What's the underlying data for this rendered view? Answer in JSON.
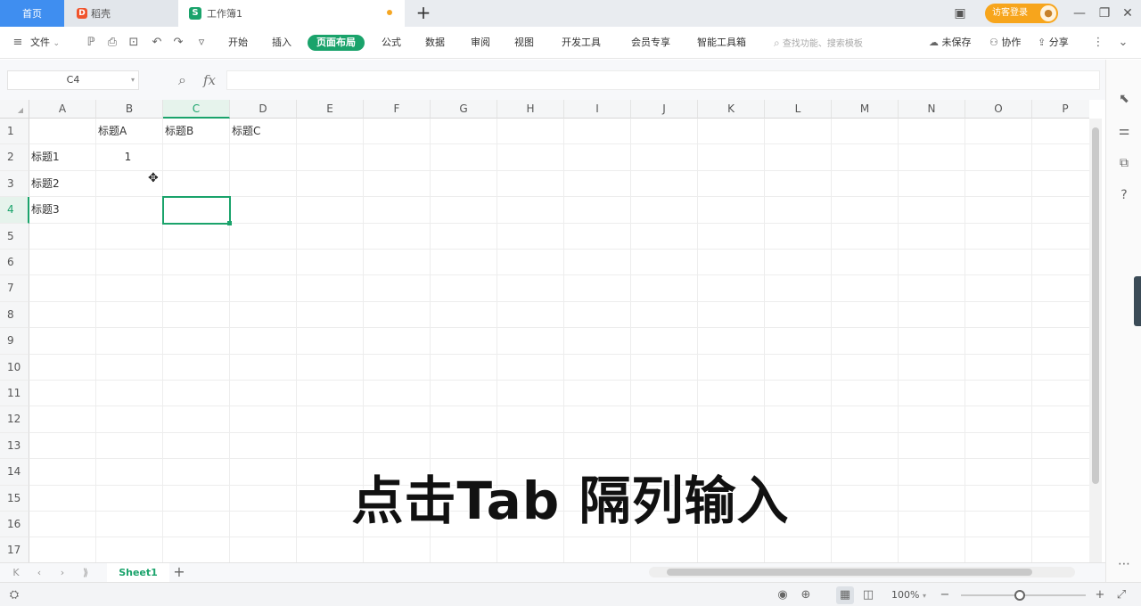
{
  "tabs": {
    "home": "首页",
    "docer": "稻壳",
    "workbook": "工作簿1",
    "new_tab": "+"
  },
  "account": {
    "login_label": "访客登录"
  },
  "menu": {
    "file": "文件",
    "items": [
      "开始",
      "插入",
      "页面布局",
      "公式",
      "数据",
      "审阅",
      "视图",
      "开发工具",
      "会员专享",
      "智能工具箱"
    ],
    "active": "页面布局",
    "search_placeholder": "查找功能、搜索模板",
    "unsaved": "未保存",
    "collab": "协作",
    "share": "分享"
  },
  "formula_bar": {
    "cell_ref": "C4",
    "fx": "fx",
    "content": ""
  },
  "grid": {
    "columns": [
      "A",
      "B",
      "C",
      "D",
      "E",
      "F",
      "G",
      "H",
      "I",
      "J",
      "K",
      "L",
      "M",
      "N",
      "O",
      "P"
    ],
    "rows": [
      "1",
      "2",
      "3",
      "4",
      "5",
      "6",
      "7",
      "8",
      "9",
      "10",
      "11",
      "12",
      "13",
      "14",
      "15",
      "16",
      "17"
    ],
    "selected_column": "C",
    "selected_row": "4",
    "cells": {
      "B1": "标题A",
      "C1": "标题B",
      "D1": "标题C",
      "A2": "标题1",
      "A3": "标题2",
      "A4": "标题3",
      "B2": "1"
    }
  },
  "sheets": {
    "active": "Sheet1",
    "add": "+"
  },
  "status": {
    "zoom": "100%"
  },
  "caption": "点击Tab 隔列输入",
  "colors": {
    "accent": "#1aa36b",
    "login": "#f7a51c",
    "home_tab": "#3f8ef0"
  },
  "icons": {
    "titlebar": [
      "layout-icon",
      "minimize-icon",
      "restore-icon",
      "close-icon"
    ],
    "side": [
      "cursor-icon",
      "settings-icon",
      "backup-icon",
      "help-icon"
    ]
  }
}
